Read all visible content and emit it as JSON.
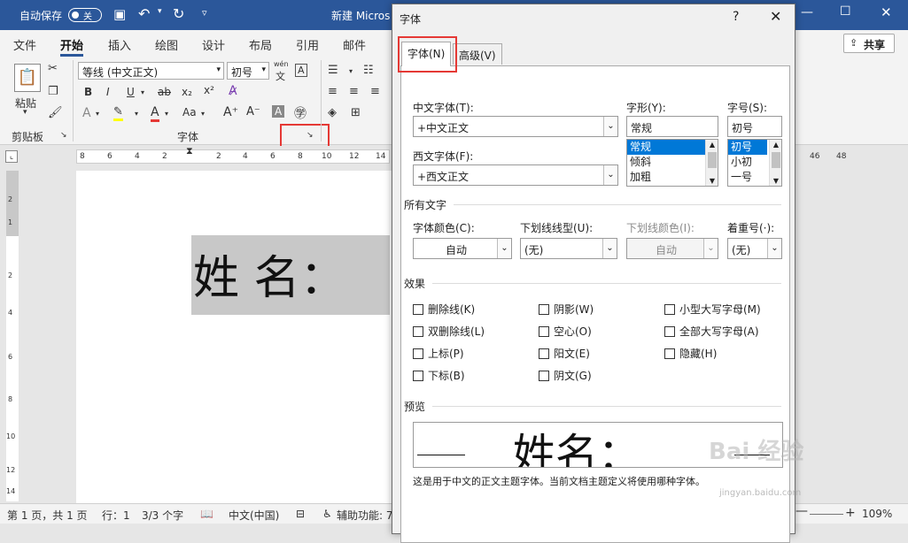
{
  "titlebar": {
    "autosave_label": "自动保存",
    "toggle_state": "关",
    "doc_title": "新建 Micros"
  },
  "menu_tabs": [
    "文件",
    "开始",
    "插入",
    "绘图",
    "设计",
    "布局",
    "引用",
    "邮件"
  ],
  "active_tab": "开始",
  "share_label": "共享",
  "ribbon": {
    "paste_label": "粘贴",
    "clipboard_group": "剪贴板",
    "font_group": "字体",
    "font_name": "等线 (中文正文)",
    "font_size": "初号",
    "wen_label": "wén",
    "bold": "B",
    "italic": "I",
    "underline": "U",
    "strike": "ab",
    "sub": "x₂",
    "sup": "x²",
    "case_label": "Aa",
    "grow_label": "A^",
    "shrink_label": "Aˇ"
  },
  "ruler_ticks": [
    "8",
    "6",
    "4",
    "2",
    "2",
    "4",
    "6",
    "8",
    "10",
    "12",
    "14",
    "46",
    "48"
  ],
  "vruler_ticks": [
    "2",
    "1",
    "2",
    "4",
    "6",
    "8",
    "10",
    "12",
    "14"
  ],
  "document": {
    "text": "姓 名："
  },
  "statusbar": {
    "page": "第 1 页，共 1 页",
    "line": "行：1",
    "chars": "3/3 个字",
    "lang": "中文(中国)",
    "accessibility": "辅助功能: 7",
    "zoom": "109%"
  },
  "dialog": {
    "title": "字体",
    "help": "?",
    "close": "✕",
    "tabs": [
      "字体(N)",
      "高级(V)"
    ],
    "cn_font_label": "中文字体(T):",
    "cn_font_value": "+中文正文",
    "west_font_label": "西文字体(F):",
    "west_font_value": "+西文正文",
    "style_label": "字形(Y):",
    "style_value": "常规",
    "style_options": [
      "常规",
      "倾斜",
      "加粗"
    ],
    "size_label": "字号(S):",
    "size_value": "初号",
    "size_options": [
      "初号",
      "小初",
      "一号"
    ],
    "all_text_label": "所有文字",
    "font_color_label": "字体颜色(C):",
    "font_color_value": "自动",
    "underline_type_label": "下划线线型(U):",
    "underline_type_value": "(无)",
    "underline_color_label": "下划线颜色(I):",
    "underline_color_value": "自动",
    "emphasis_label": "着重号(·):",
    "emphasis_value": "(无)",
    "effects_label": "效果",
    "effects": [
      [
        "删除线(K)",
        "阴影(W)",
        "小型大写字母(M)"
      ],
      [
        "双删除线(L)",
        "空心(O)",
        "全部大写字母(A)"
      ],
      [
        "上标(P)",
        "阳文(E)",
        "隐藏(H)"
      ],
      [
        "下标(B)",
        "阴文(G)",
        ""
      ]
    ],
    "preview_label": "预览",
    "preview_text": "姓名：",
    "preview_note": "这是用于中文的正文主题字体。当前文档主题定义将使用哪种字体。"
  },
  "watermark": {
    "main": "Bai 经验",
    "sub": "jingyan.baidu.com"
  },
  "colors": {
    "titlebar": "#2b579a",
    "selection": "#0078d7",
    "highlight_box": "#e53935"
  }
}
